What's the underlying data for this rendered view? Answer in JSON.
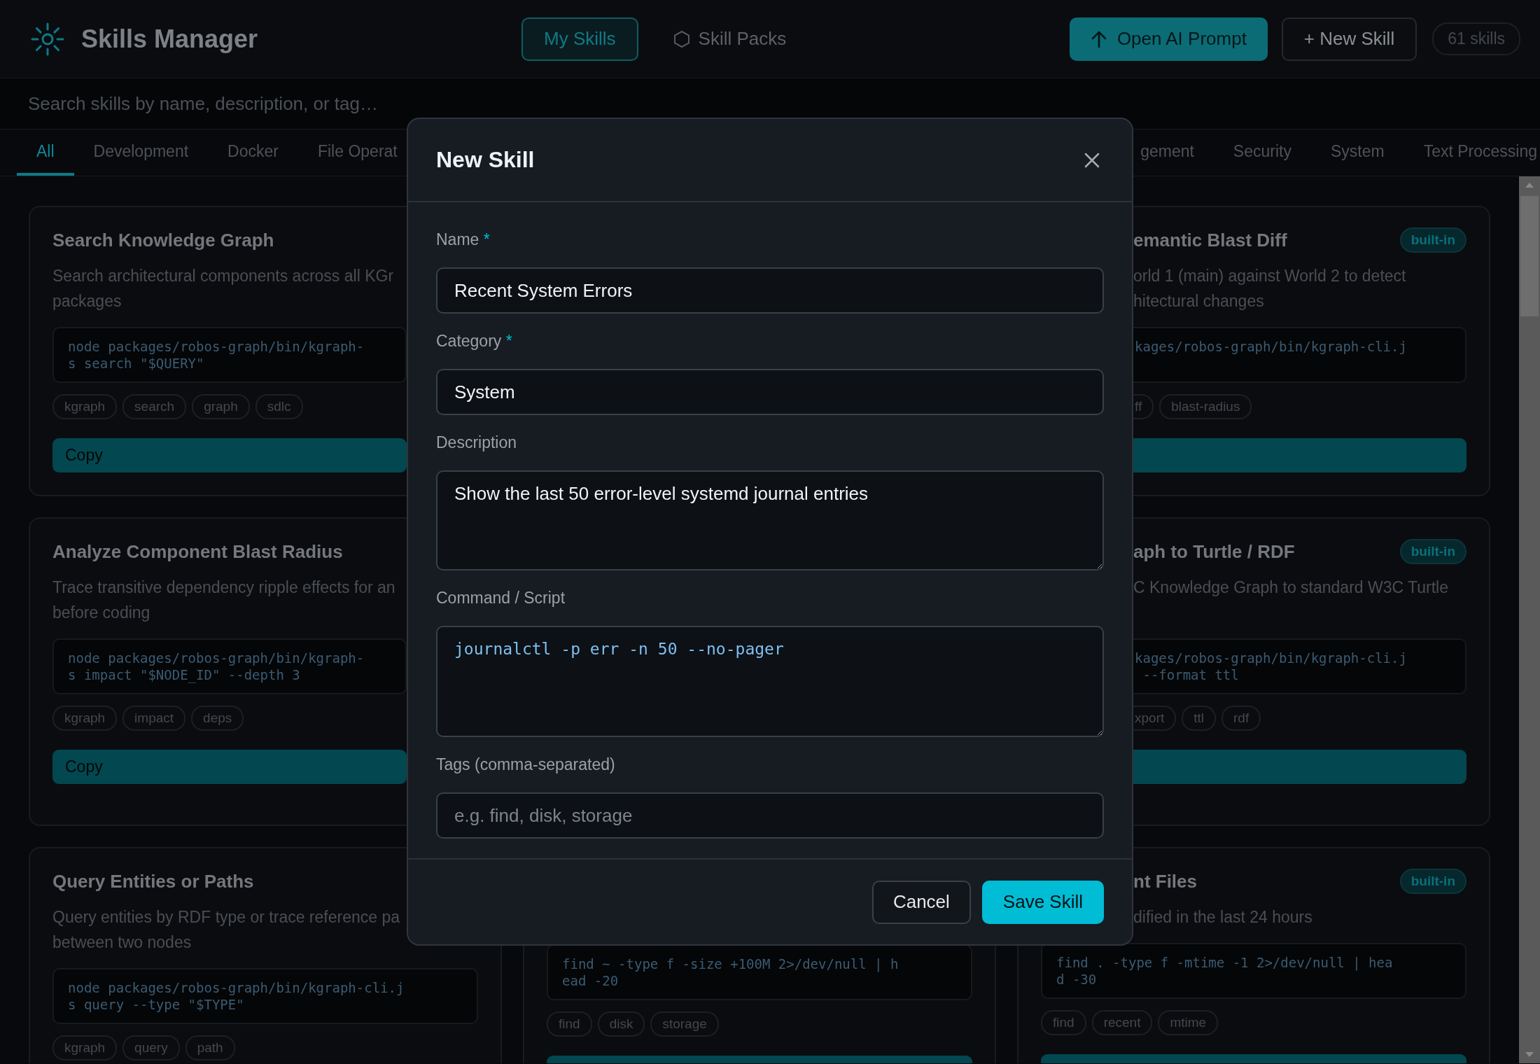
{
  "header": {
    "title": "Skills Manager",
    "nav": [
      {
        "label": "My Skills",
        "selected": true
      },
      {
        "label": "Skill Packs",
        "selected": false
      }
    ],
    "actions": [
      {
        "kind": "primary",
        "label": "Open AI Prompt"
      },
      {
        "kind": "secondary",
        "label": "+ New Skill"
      }
    ],
    "count": "61 skills"
  },
  "search": {
    "placeholder": "Search skills by name, description, or tag…"
  },
  "category_tabs": {
    "left": [
      {
        "label": "All",
        "selected": true
      },
      {
        "label": "Development",
        "selected": false
      },
      {
        "label": "Docker",
        "selected": false
      },
      {
        "label": "File Operat",
        "selected": false
      }
    ],
    "right": [
      {
        "label": "gement",
        "selected": false
      },
      {
        "label": "Security",
        "selected": false
      },
      {
        "label": "System",
        "selected": false
      },
      {
        "label": "Text Processing",
        "selected": false
      }
    ]
  },
  "columns": [
    {
      "cards": [
        {
          "title": "Search Knowledge Graph",
          "description_lines": [
            "Search architectural components across all KGr",
            "packages"
          ],
          "code_lines": [
            "node packages/robos-graph/bin/kgraph-",
            "s search \"$QUERY\""
          ],
          "tags": [
            "kgraph",
            "search",
            "graph",
            "sdlc"
          ],
          "copy_button": true,
          "copy_label": "Copy"
        },
        {
          "title": "Analyze Component Blast Radius",
          "description_lines": [
            "Trace transitive dependency ripple effects for an",
            "before coding"
          ],
          "code_lines": [
            "node packages/robos-graph/bin/kgraph-",
            "s impact \"$NODE_ID\" --depth 3"
          ],
          "tags": [
            "kgraph",
            "impact",
            "deps"
          ],
          "copy_button": true,
          "copy_label": "Copy"
        },
        {
          "title": "Query Entities or Paths",
          "description_lines": [
            "Query entities by RDF type or trace reference pa",
            "between two nodes"
          ],
          "code_lines": [
            "node packages/robos-graph/bin/kgraph-cli.j",
            "s query --type \"$TYPE\""
          ],
          "tags": [
            "kgraph",
            "query",
            "path"
          ]
        }
      ]
    },
    {
      "cards": [
        {
          "code_lines": [
            "find ~ -type f -size +100M 2>/dev/null | h",
            "ead -20"
          ],
          "tags": [
            "find",
            "disk",
            "storage"
          ],
          "copy_button": true
        }
      ]
    },
    {
      "cards": [
        {
          "title": "emantic Blast Diff",
          "badge": "built-in",
          "description_lines": [
            "orld 1 (main) against World 2 to detect",
            "hitectural changes"
          ],
          "code_lines": [
            "kages/robos-graph/bin/kgraph-cli.j"
          ],
          "tags": [
            "ff",
            "blast-radius"
          ],
          "copy_button": true
        },
        {
          "title": "aph to Turtle / RDF",
          "badge": "built-in",
          "description_lines": [
            "C Knowledge Graph to standard W3C Turtle"
          ],
          "code_lines": [
            "kages/robos-graph/bin/kgraph-cli.j",
            " --format ttl"
          ],
          "tags": [
            "xport",
            "ttl",
            "rdf"
          ],
          "copy_button": true
        },
        {
          "title": "nt Files",
          "badge": "built-in",
          "description_lines": [
            "dified in the last 24 hours"
          ],
          "code_lines": [
            "find . -type f -mtime -1 2>/dev/null | hea",
            "d -30"
          ],
          "tags": [
            "find",
            "recent",
            "mtime"
          ],
          "copy_button": true
        }
      ]
    }
  ],
  "dialog": {
    "title": "New Skill",
    "fields": [
      {
        "kind": "input",
        "label": "Name",
        "required_mark": "*",
        "value": "Recent System Errors"
      },
      {
        "kind": "input",
        "label": "Category",
        "required_mark": "*",
        "value": "System"
      },
      {
        "kind": "textarea",
        "label": "Description",
        "value": "Show the last 50 error-level systemd journal entries"
      },
      {
        "kind": "code",
        "label": "Command / Script",
        "value": "journalctl -p err -n 50 --no-pager"
      },
      {
        "kind": "input",
        "label": "Tags (comma-separated)",
        "placeholder": "e.g. find, disk, storage"
      }
    ],
    "buttons": [
      {
        "kind": "secondary",
        "label": "Cancel"
      },
      {
        "kind": "primary",
        "label": "Save Skill"
      }
    ]
  }
}
